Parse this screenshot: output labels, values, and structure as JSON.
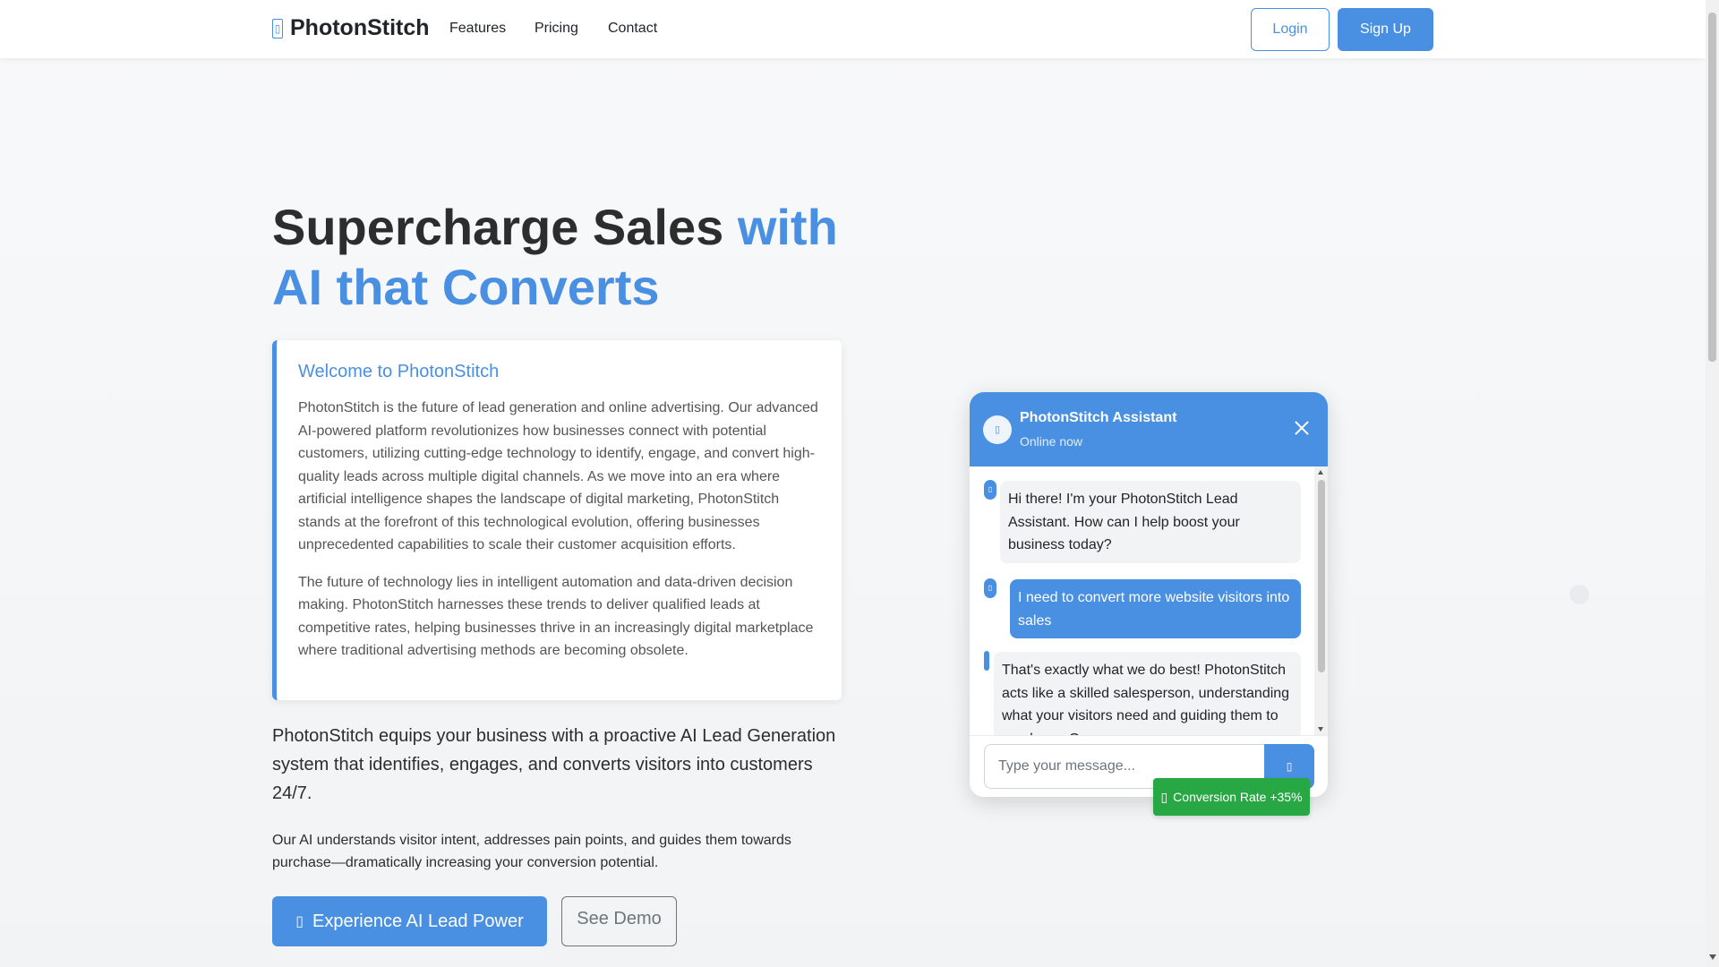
{
  "nav": {
    "brand_icon": "rocket-icon",
    "brand": "PhotonStitch",
    "links": [
      "Features",
      "Pricing",
      "Contact"
    ],
    "login": "Login",
    "signup": "Sign Up"
  },
  "hero": {
    "title_main": "Supercharge Sales",
    "title_accent": "with AI that Converts",
    "accent_color": "#4a90e2"
  },
  "welcome": {
    "title": "Welcome to PhotonStitch",
    "paragraphs": [
      "PhotonStitch is the future of lead generation and online advertising. Our advanced AI-powered platform revolutionizes how businesses connect with potential customers, utilizing cutting-edge technology to identify, engage, and convert high-quality leads across multiple digital channels. As we move into an era where artificial intelligence shapes the landscape of digital marketing, PhotonStitch stands at the forefront of this technological evolution, offering businesses unprecedented capabilities to scale their customer acquisition efforts.",
      "The future of technology lies in intelligent automation and data-driven decision making. PhotonStitch harnesses these trends to deliver qualified leads at competitive rates, helping businesses thrive in an increasingly digital marketplace where traditional advertising methods are becoming obsolete."
    ]
  },
  "lead": "PhotonStitch equips your business with a proactive AI Lead Generation system that identifies, engages, and converts visitors into customers 24/7.",
  "sub": "Our AI understands visitor intent, addresses pain points, and guides them towards purchase—dramatically increasing your conversion potential.",
  "cta": {
    "primary": "Experience AI Lead Power",
    "primary_icon": "robot-icon",
    "demo": "See Demo"
  },
  "chat": {
    "name": "PhotonStitch Assistant",
    "status": "Online now",
    "messages": [
      {
        "from": "bot",
        "text": "Hi there! I'm your PhotonStitch Lead Assistant. How can I help boost your business today?"
      },
      {
        "from": "user",
        "text": "I need to convert more website visitors into sales"
      },
      {
        "from": "bot",
        "text": "That's exactly what we do best! PhotonStitch acts like a skilled salesperson, understanding what your visitors need and guiding them to purchase. Our "
      }
    ],
    "placeholder": "Type your message...",
    "send_icon": "paper-plane-icon"
  },
  "badge": {
    "icon": "chart-line-icon",
    "label": "Conversion Rate +35%"
  }
}
